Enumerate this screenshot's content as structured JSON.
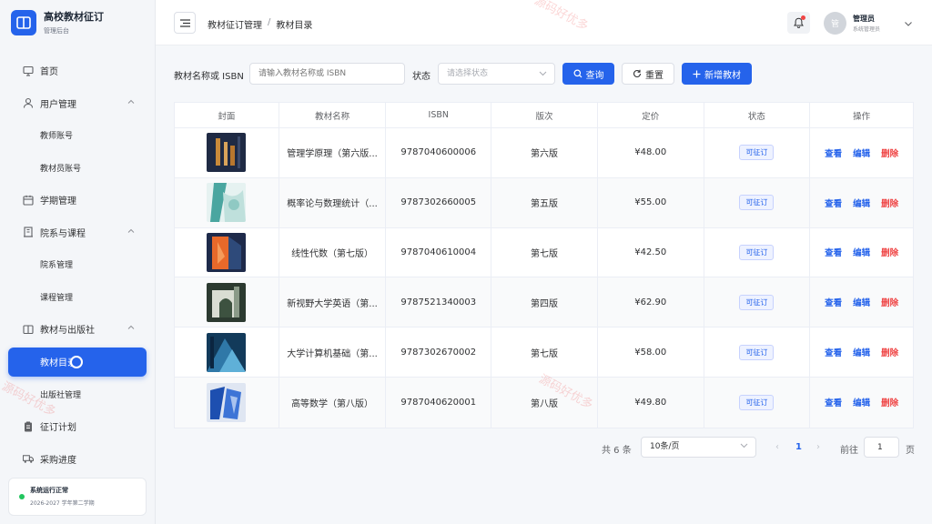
{
  "brand": {
    "title": "高校教材征订",
    "subtitle": "管理后台"
  },
  "sidebar": {
    "items": [
      {
        "label": "首页",
        "icon": "dashboard-icon"
      },
      {
        "label": "用户管理",
        "icon": "user-icon"
      },
      {
        "label": "教师账号",
        "sub": true
      },
      {
        "label": "教材员账号",
        "sub": true
      },
      {
        "label": "学期管理",
        "icon": "calendar-icon"
      },
      {
        "label": "院系与课程",
        "icon": "building-icon"
      },
      {
        "label": "院系管理",
        "sub": true
      },
      {
        "label": "课程管理",
        "sub": true
      },
      {
        "label": "教材与出版社",
        "icon": "book-icon"
      },
      {
        "label": "教材目录",
        "sub": true,
        "active": true
      },
      {
        "label": "出版社管理",
        "sub": true
      },
      {
        "label": "征订计划",
        "icon": "clipboard-icon"
      },
      {
        "label": "采购进度",
        "icon": "truck-icon"
      }
    ],
    "status": {
      "title": "系统运行正常",
      "term": "2026-2027 学年第二学期"
    }
  },
  "header": {
    "breadcrumb": [
      "教材征订管理",
      "教材目录"
    ],
    "user": {
      "avatar": "管",
      "name": "管理员",
      "role": "系统管理员"
    }
  },
  "filters": {
    "name_label": "教材名称或 ISBN",
    "name_placeholder": "请输入教材名称或 ISBN",
    "status_label": "状态",
    "status_placeholder": "请选择状态",
    "search_btn": "查询",
    "reset_btn": "重置",
    "add_btn": "新增教材"
  },
  "table": {
    "headers": [
      "封面",
      "教材名称",
      "ISBN",
      "版次",
      "定价",
      "状态",
      "操作"
    ],
    "rows": [
      {
        "name": "管理学原理（第六版...",
        "isbn": "9787040600006",
        "edition": "第六版",
        "price": "¥48.00",
        "status": "可征订"
      },
      {
        "name": "概率论与数理统计（...",
        "isbn": "9787302660005",
        "edition": "第五版",
        "price": "¥55.00",
        "status": "可征订"
      },
      {
        "name": "线性代数（第七版）",
        "isbn": "9787040610004",
        "edition": "第七版",
        "price": "¥42.50",
        "status": "可征订"
      },
      {
        "name": "新视野大学英语（第...",
        "isbn": "9787521340003",
        "edition": "第四版",
        "price": "¥62.90",
        "status": "可征订"
      },
      {
        "name": "大学计算机基础（第...",
        "isbn": "9787302670002",
        "edition": "第七版",
        "price": "¥58.00",
        "status": "可征订"
      },
      {
        "name": "高等数学（第八版）",
        "isbn": "9787040620001",
        "edition": "第八版",
        "price": "¥49.80",
        "status": "可征订"
      }
    ],
    "ops": {
      "view": "查看",
      "edit": "编辑",
      "delete": "删除"
    }
  },
  "pagination": {
    "total": "共 6 条",
    "page_size": "10条/页",
    "current": "1",
    "goto": "前往",
    "goto_value": "1",
    "page_unit": "页"
  },
  "watermark": "源码好优多"
}
